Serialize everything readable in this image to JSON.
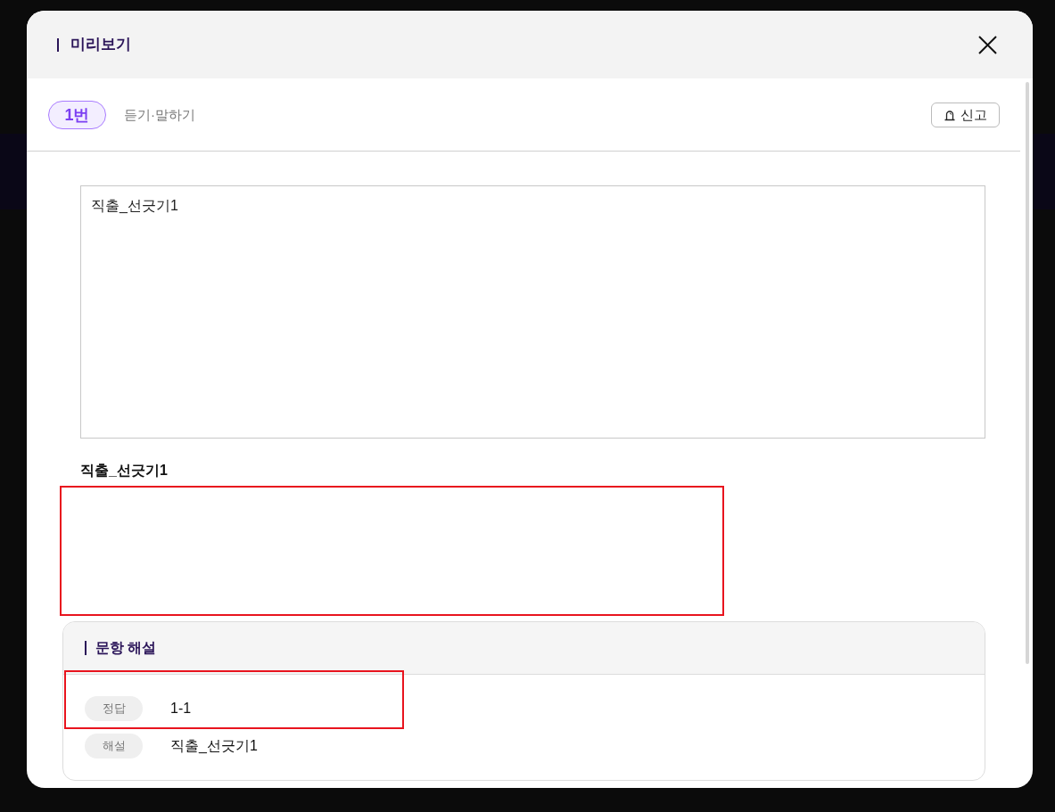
{
  "dialog": {
    "title": "미리보기"
  },
  "question": {
    "number": "1번",
    "category": "듣기·말하기"
  },
  "report_button": {
    "label": "신고"
  },
  "passage": {
    "text": "직출_선긋기1"
  },
  "question_title": "직출_선긋기1",
  "answer_area": {
    "highlighted": true
  },
  "explanation": {
    "title": "문항 해설",
    "rows": [
      {
        "label": "정답",
        "value": "1-1",
        "highlighted": true
      },
      {
        "label": "해설",
        "value": "직출_선긋기1",
        "highlighted": false
      }
    ]
  }
}
